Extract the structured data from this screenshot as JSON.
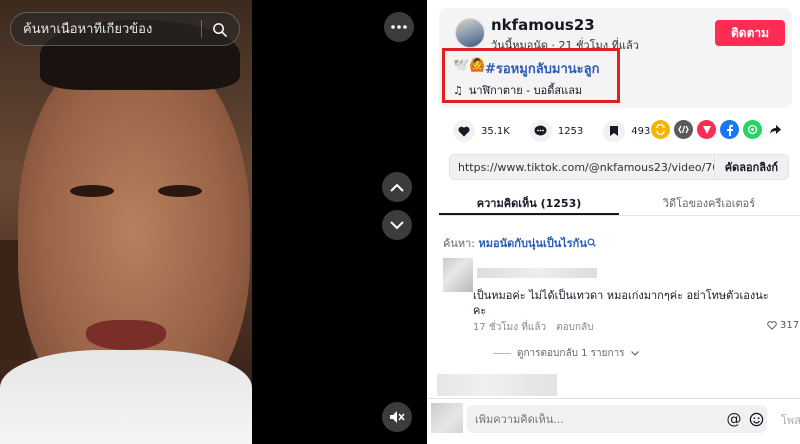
{
  "video": {
    "search_placeholder": "ค้นหาเนื้อหาที่เกี่ยวข้อง"
  },
  "author": {
    "username": "nkfamous23",
    "meta": "วันนี้หมอนัด · 21 ชั่วโมง ที่แล้ว",
    "follow_label": "ติดตาม"
  },
  "caption": {
    "emojis": "🕊️🙆",
    "hashtag": "#รอหมูกลับมานะลูก",
    "music_icon": "♫",
    "music": "นาฬิกาตาย - บอดี้สแลม"
  },
  "stats": {
    "likes": "35.1K",
    "comments": "1253",
    "saves": "493"
  },
  "share_colors": {
    "repost": "#f5b400",
    "embed": "#5a5a5a",
    "send": "#fe2c55",
    "facebook": "#1877f2",
    "whatsapp": "#25d366",
    "forward": "#161823"
  },
  "link": {
    "url": "https://www.tiktok.com/@nkfamous23/video/7600...",
    "copy_label": "คัดลอกลิงก์"
  },
  "tabs": [
    {
      "label": "ความคิดเห็น (1253)"
    },
    {
      "label": "วิดีโอของครีเอเตอร์"
    }
  ],
  "search_line": {
    "prefix": "ค้นหา:",
    "query": "หมอนัดกับนุ่นเป็นไรกัน"
  },
  "comment": {
    "text": "เป็นหมอค่ะ ไม่ได้เป็นเทวดา หมอเก่งมากๆค่ะ อย่าโทษตัวเองนะคะ",
    "time": "17 ชั่วโมง ที่แล้ว",
    "reply": "ตอบกลับ",
    "likes": "317",
    "view_replies": "ดูการตอบกลับ 1 รายการ"
  },
  "composer": {
    "placeholder": "เพิ่มความคิดเห็น...",
    "post_label": "โพส"
  }
}
